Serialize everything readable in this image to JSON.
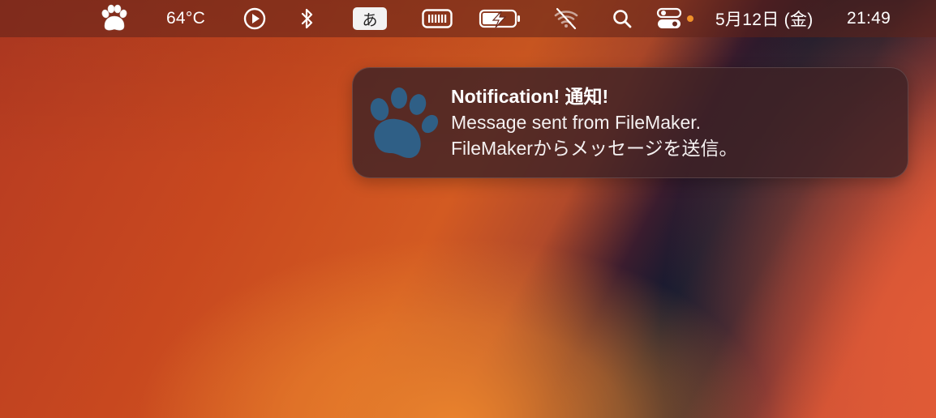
{
  "menubar": {
    "paw_icon": "paw-icon",
    "temperature": "64°C",
    "play_icon": "play-circle-icon",
    "bluetooth_icon": "bluetooth-icon",
    "input_method": "あ",
    "battery_meter_icon": "battery-meter-icon",
    "battery_icon": "battery-charging-icon",
    "wifi_icon": "wifi-off-icon",
    "search_icon": "search-icon",
    "control_center_icon": "control-center-icon",
    "date": "5月12日 (金)",
    "time": "21:49"
  },
  "notification": {
    "icon": "paw-icon",
    "title": "Notification! 通知!",
    "line1": "Message sent from FileMaker.",
    "line2": "FileMakerからメッセージを送信。"
  },
  "colors": {
    "paw_blue": "#2f5f86",
    "status_dot": "#f0922a"
  }
}
